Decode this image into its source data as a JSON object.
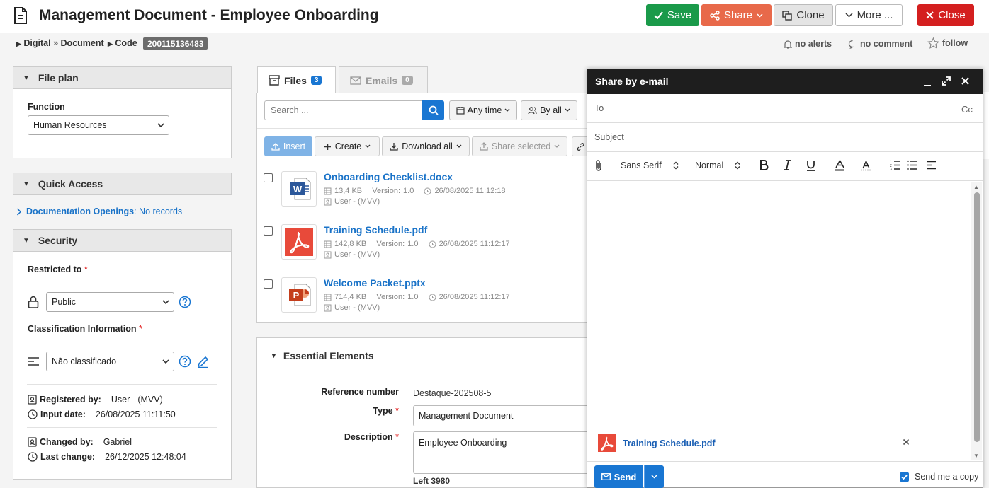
{
  "header": {
    "title": "Management Document - Employee Onboarding",
    "save": "Save",
    "share": "Share",
    "clone": "Clone",
    "more": "More ...",
    "close": "Close"
  },
  "breadcrumb": {
    "digital": "Digital",
    "sep": "»",
    "document": "Document",
    "code_label": "Code",
    "code_value": "200115136483",
    "alerts": "no alerts",
    "comments": "no comment",
    "follow": "follow"
  },
  "file_plan": {
    "title": "File plan",
    "function_label": "Function",
    "function_value": "Human Resources"
  },
  "quick_access": {
    "title": "Quick Access",
    "link": "Documentation Openings",
    "link_value": ": No records"
  },
  "security": {
    "title": "Security",
    "restricted_label": "Restricted to",
    "restricted_value": "Public",
    "classification_label": "Classification Information",
    "classification_value": "Não classificado",
    "registered_by_label": "Registered by:",
    "registered_by": "User - (MVV)",
    "input_date_label": "Input date:",
    "input_date": "26/08/2025 11:11:50",
    "changed_by_label": "Changed by:",
    "changed_by": "Gabriel",
    "last_change_label": "Last change:",
    "last_change": "26/12/2025 12:48:04",
    "required_mark": "*"
  },
  "tabs": {
    "files_label": "Files",
    "files_count": "3",
    "emails_label": "Emails",
    "emails_count": "0"
  },
  "toolbar": {
    "search_placeholder": "Search ...",
    "any_time": "Any time",
    "by_all": "By all",
    "insert": "Insert",
    "create": "Create",
    "download_all": "Download all",
    "share_selected": "Share selected"
  },
  "files": [
    {
      "name": "Onboarding Checklist.docx",
      "size": "13,4 KB",
      "version_label": "Version:",
      "version": "1.0",
      "date": "26/08/2025 11:12:18",
      "user": "User - (MVV)"
    },
    {
      "name": "Training Schedule.pdf",
      "size": "142,8 KB",
      "version_label": "Version:",
      "version": "1.0",
      "date": "26/08/2025 11:12:17",
      "user": "User - (MVV)"
    },
    {
      "name": "Welcome Packet.pptx",
      "size": "714,4 KB",
      "version_label": "Version:",
      "version": "1.0",
      "date": "26/08/2025 11:12:17",
      "user": "User - (MVV)"
    }
  ],
  "essential": {
    "title": "Essential Elements",
    "reference_label": "Reference number",
    "reference_value": "Destaque-202508-5",
    "type_label": "Type",
    "type_value": "Management Document",
    "description_label": "Description",
    "description_value": "Employee Onboarding",
    "left_label": "Left",
    "left_value": "3980"
  },
  "email": {
    "title": "Share by e-mail",
    "to_label": "To",
    "cc_label": "Cc",
    "subject_label": "Subject",
    "font": "Sans Serif",
    "size": "Normal",
    "attachment": "Training Schedule.pdf",
    "send": "Send",
    "send_copy": "Send me a copy"
  },
  "colors": {
    "save": "#1a9a4a",
    "share": "#e8694a",
    "close": "#d41f1f",
    "primary": "#1976d2",
    "link": "#1a73c8",
    "pdf": "#e84a3a",
    "word": "#2b579a",
    "ppt": "#c43e1c"
  }
}
